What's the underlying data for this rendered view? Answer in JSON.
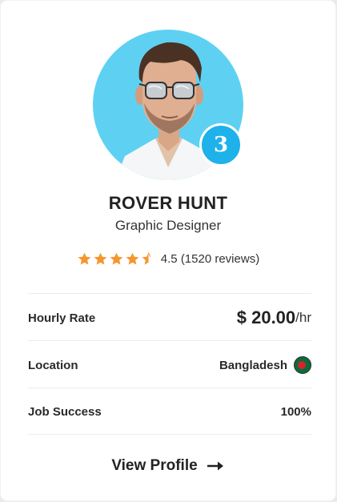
{
  "profile": {
    "name": "ROVER HUNT",
    "title": "Graphic Designer",
    "level": "3"
  },
  "rating": {
    "value": 4.5,
    "max": 5,
    "text": "4.5 (1520 reviews)",
    "star_color": "#f5962d"
  },
  "details": {
    "hourly_rate_label": "Hourly Rate",
    "hourly_rate_amount": "$ 20.00",
    "hourly_rate_unit": "/hr",
    "location_label": "Location",
    "location_value": "Bangladesh",
    "location_flag": "bangladesh-flag-icon",
    "job_success_label": "Job Success",
    "job_success_value": "100%"
  },
  "cta": {
    "label": "View Profile",
    "icon": "arrow-right-icon"
  },
  "colors": {
    "avatar_bg": "#5ed1f2",
    "badge_bg": "#1fb1e9"
  }
}
